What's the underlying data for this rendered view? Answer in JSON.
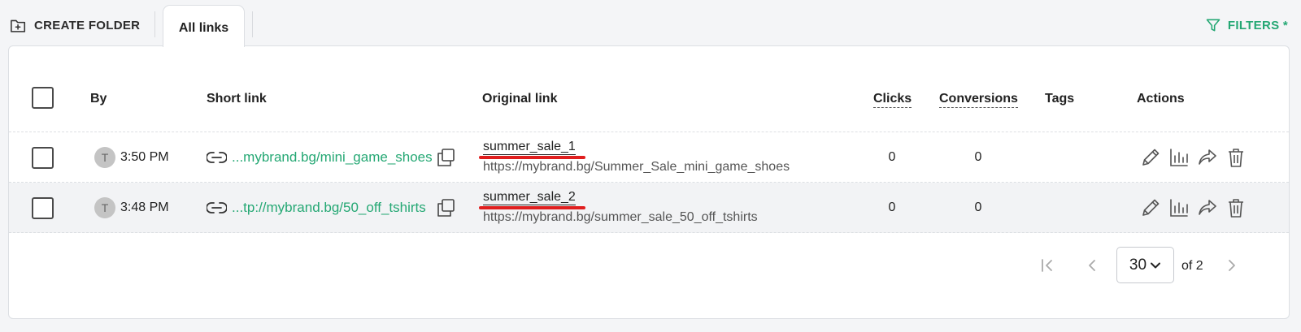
{
  "toolbar": {
    "create_folder_label": "CREATE FOLDER",
    "tab_all_links": "All links",
    "filters_label": "FILTERS *",
    "accent_color": "#25a874"
  },
  "table": {
    "headers": {
      "by": "By",
      "short_link": "Short link",
      "original_link": "Original link",
      "clicks": "Clicks",
      "conversions": "Conversions",
      "tags": "Tags",
      "actions": "Actions"
    },
    "rows": [
      {
        "avatar_initial": "T",
        "time": "3:50 PM",
        "short_link": "...mybrand.bg/mini_game_shoes",
        "original_name": "summer_sale_1",
        "original_url": "https://mybrand.bg/Summer_Sale_mini_game_shoes",
        "clicks": "0",
        "conversions": "0",
        "tags": ""
      },
      {
        "avatar_initial": "T",
        "time": "3:48 PM",
        "short_link": "...tp://mybrand.bg/50_off_tshirts",
        "original_name": "summer_sale_2",
        "original_url": "https://mybrand.bg/summer_sale_50_off_tshirts",
        "clicks": "0",
        "conversions": "0",
        "tags": ""
      }
    ],
    "action_icons": [
      "edit-icon",
      "stats-icon",
      "share-icon",
      "delete-icon"
    ]
  },
  "pagination": {
    "page_size": "30",
    "of_text": "of 2"
  }
}
